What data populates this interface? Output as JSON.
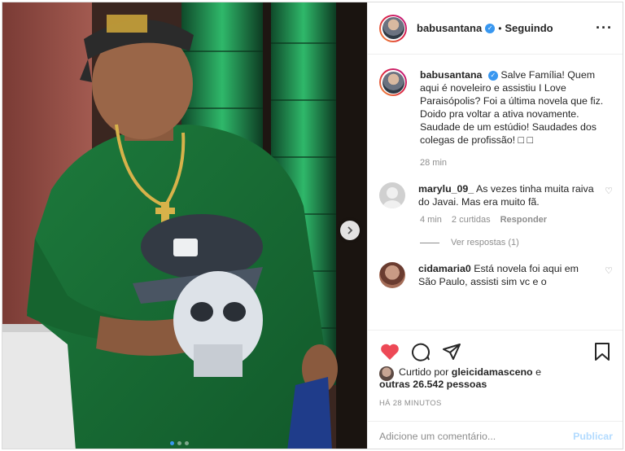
{
  "post": {
    "username": "babusantana",
    "follow_label": "Seguindo",
    "separator": "•",
    "more_icon": "more-dots-icon",
    "caption_text": "Salve Família! Quem aqui é noveleiro e assistiu I Love Paraisópolis? Foi a última novela que fiz. Doido pra voltar a ativa novamente. Saudade de um estúdio! Saudades dos colegas de profissão! □ □",
    "caption_time": "28 min",
    "photo": {
      "carousel_dots": 3,
      "active_dot": 1,
      "next_icon": "chevron-right-icon"
    }
  },
  "comments": [
    {
      "username": "marylu_09_",
      "text": "As vezes tinha muita raiva do Javai. Mas era muito fã.",
      "time": "4 min",
      "likes": "2 curtidas",
      "reply_label": "Responder",
      "view_replies": "Ver respostas (1)"
    },
    {
      "username": "cidamaria0",
      "text": "Está novela foi aqui em São Paulo, assisti sim vc e o"
    }
  ],
  "likes_info": {
    "prefix": "Curtido por",
    "user": "gleicidamasceno",
    "conjunction": "e",
    "others": "outras 26.542 pessoas"
  },
  "posted_time": "HÁ 28 MINUTOS",
  "add_comment": {
    "placeholder": "Adicione um comentário...",
    "publish_label": "Publicar"
  },
  "colors": {
    "accent_blue": "#3897f0",
    "like_red": "#ed4956",
    "publish_disabled": "#b3dbff",
    "muted_text": "#8e8e8e",
    "shirt_green": "#1f7a3a"
  }
}
